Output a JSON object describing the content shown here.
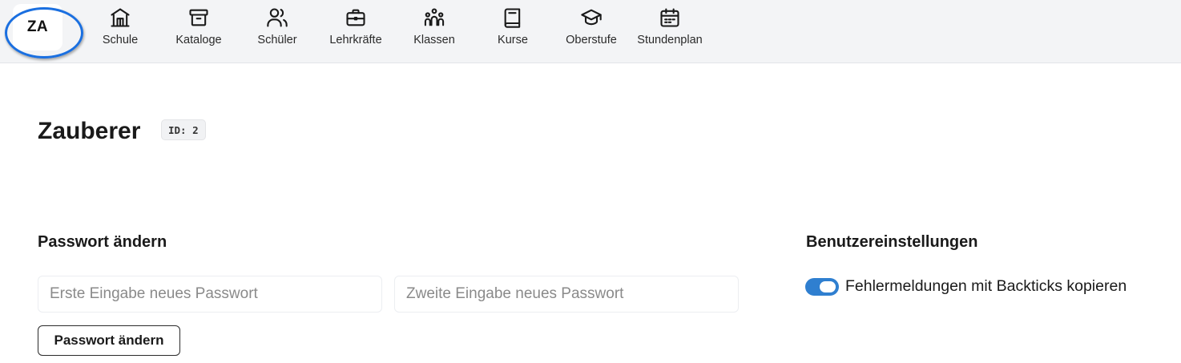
{
  "user": {
    "initials": "ZA",
    "name": "Zauberer",
    "id_badge": "ID: 2"
  },
  "nav": {
    "items": [
      {
        "label": "Schule",
        "icon": "building-icon"
      },
      {
        "label": "Kataloge",
        "icon": "archive-icon"
      },
      {
        "label": "Schüler",
        "icon": "users-icon"
      },
      {
        "label": "Lehrkräfte",
        "icon": "briefcase-icon"
      },
      {
        "label": "Klassen",
        "icon": "group-icon"
      },
      {
        "label": "Kurse",
        "icon": "book-icon"
      },
      {
        "label": "Oberstufe",
        "icon": "graduation-cap-icon"
      },
      {
        "label": "Stundenplan",
        "icon": "calendar-icon"
      }
    ]
  },
  "password_section": {
    "heading": "Passwort ändern",
    "first_placeholder": "Erste Eingabe neues Passwort",
    "second_placeholder": "Zweite Eingabe neues Passwort",
    "first_value": "",
    "second_value": "",
    "button_label": "Passwort ändern"
  },
  "settings_section": {
    "heading": "Benutzereinstellungen",
    "backticks_toggle_label": "Fehlermeldungen mit Backticks kopieren",
    "backticks_toggle_on": true
  },
  "colors": {
    "accent": "#2f7fd0",
    "highlight_ring": "#1a6fe0",
    "topbar_bg": "#f3f4f6"
  }
}
